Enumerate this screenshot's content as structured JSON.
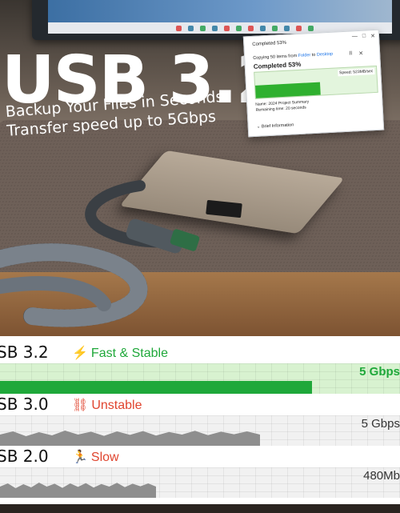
{
  "hero": {
    "title": "USB 3.2",
    "subtitle_line1": "Backup Your Files in Seconds",
    "subtitle_line2": "Transfer speed up to 5Gbps"
  },
  "dialog": {
    "title": "Completed 53%",
    "copying_prefix": "Copying 50 items from",
    "copying_from": "Folder",
    "copying_mid": "to",
    "copying_to": "Desktop",
    "completed": "Completed 53%",
    "progress": 0.53,
    "speed": "Speed: 523MB/sec",
    "name": "Name: 2024 Project Summary",
    "remaining": "Remaining time: 20 seconds",
    "brief": "Brief Information",
    "controls": [
      "—",
      "□",
      "✕"
    ],
    "pause_controls": [
      "II",
      "✕"
    ]
  },
  "comparison": [
    {
      "label": "SB 3.2",
      "badge": "Fast & Stable",
      "badge_icon": "lightning-icon",
      "badge_color": "#1fa83a",
      "value": "5 Gbps",
      "value_color": "#1fa83a",
      "fill_color": "#1fa83a",
      "fill": 0.78
    },
    {
      "label": "SB 3.0",
      "badge": "Unstable",
      "badge_icon": "broken-link-icon",
      "badge_color": "#e0452f",
      "value": "5 Gbps",
      "value_color": "#333333",
      "fill_color": "#8e8e8e",
      "fill": 0.65
    },
    {
      "label": "SB 2.0",
      "badge": "Slow",
      "badge_icon": "running-person-icon",
      "badge_color": "#e0452f",
      "value": "480Mb",
      "value_color": "#333333",
      "fill_color": "#8e8e8e",
      "fill": 0.39
    }
  ]
}
